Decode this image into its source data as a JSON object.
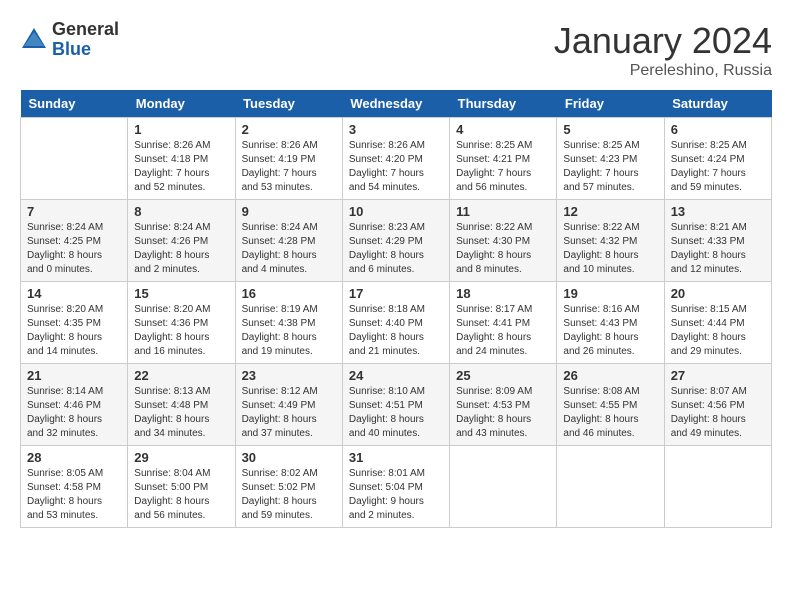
{
  "header": {
    "logo": {
      "general": "General",
      "blue": "Blue"
    },
    "month": "January 2024",
    "location": "Pereleshino, Russia"
  },
  "weekdays": [
    "Sunday",
    "Monday",
    "Tuesday",
    "Wednesday",
    "Thursday",
    "Friday",
    "Saturday"
  ],
  "weeks": [
    [
      {
        "day": "",
        "info": ""
      },
      {
        "day": "1",
        "info": "Sunrise: 8:26 AM\nSunset: 4:18 PM\nDaylight: 7 hours\nand 52 minutes."
      },
      {
        "day": "2",
        "info": "Sunrise: 8:26 AM\nSunset: 4:19 PM\nDaylight: 7 hours\nand 53 minutes."
      },
      {
        "day": "3",
        "info": "Sunrise: 8:26 AM\nSunset: 4:20 PM\nDaylight: 7 hours\nand 54 minutes."
      },
      {
        "day": "4",
        "info": "Sunrise: 8:25 AM\nSunset: 4:21 PM\nDaylight: 7 hours\nand 56 minutes."
      },
      {
        "day": "5",
        "info": "Sunrise: 8:25 AM\nSunset: 4:23 PM\nDaylight: 7 hours\nand 57 minutes."
      },
      {
        "day": "6",
        "info": "Sunrise: 8:25 AM\nSunset: 4:24 PM\nDaylight: 7 hours\nand 59 minutes."
      }
    ],
    [
      {
        "day": "7",
        "info": "Sunrise: 8:24 AM\nSunset: 4:25 PM\nDaylight: 8 hours\nand 0 minutes."
      },
      {
        "day": "8",
        "info": "Sunrise: 8:24 AM\nSunset: 4:26 PM\nDaylight: 8 hours\nand 2 minutes."
      },
      {
        "day": "9",
        "info": "Sunrise: 8:24 AM\nSunset: 4:28 PM\nDaylight: 8 hours\nand 4 minutes."
      },
      {
        "day": "10",
        "info": "Sunrise: 8:23 AM\nSunset: 4:29 PM\nDaylight: 8 hours\nand 6 minutes."
      },
      {
        "day": "11",
        "info": "Sunrise: 8:22 AM\nSunset: 4:30 PM\nDaylight: 8 hours\nand 8 minutes."
      },
      {
        "day": "12",
        "info": "Sunrise: 8:22 AM\nSunset: 4:32 PM\nDaylight: 8 hours\nand 10 minutes."
      },
      {
        "day": "13",
        "info": "Sunrise: 8:21 AM\nSunset: 4:33 PM\nDaylight: 8 hours\nand 12 minutes."
      }
    ],
    [
      {
        "day": "14",
        "info": "Sunrise: 8:20 AM\nSunset: 4:35 PM\nDaylight: 8 hours\nand 14 minutes."
      },
      {
        "day": "15",
        "info": "Sunrise: 8:20 AM\nSunset: 4:36 PM\nDaylight: 8 hours\nand 16 minutes."
      },
      {
        "day": "16",
        "info": "Sunrise: 8:19 AM\nSunset: 4:38 PM\nDaylight: 8 hours\nand 19 minutes."
      },
      {
        "day": "17",
        "info": "Sunrise: 8:18 AM\nSunset: 4:40 PM\nDaylight: 8 hours\nand 21 minutes."
      },
      {
        "day": "18",
        "info": "Sunrise: 8:17 AM\nSunset: 4:41 PM\nDaylight: 8 hours\nand 24 minutes."
      },
      {
        "day": "19",
        "info": "Sunrise: 8:16 AM\nSunset: 4:43 PM\nDaylight: 8 hours\nand 26 minutes."
      },
      {
        "day": "20",
        "info": "Sunrise: 8:15 AM\nSunset: 4:44 PM\nDaylight: 8 hours\nand 29 minutes."
      }
    ],
    [
      {
        "day": "21",
        "info": "Sunrise: 8:14 AM\nSunset: 4:46 PM\nDaylight: 8 hours\nand 32 minutes."
      },
      {
        "day": "22",
        "info": "Sunrise: 8:13 AM\nSunset: 4:48 PM\nDaylight: 8 hours\nand 34 minutes."
      },
      {
        "day": "23",
        "info": "Sunrise: 8:12 AM\nSunset: 4:49 PM\nDaylight: 8 hours\nand 37 minutes."
      },
      {
        "day": "24",
        "info": "Sunrise: 8:10 AM\nSunset: 4:51 PM\nDaylight: 8 hours\nand 40 minutes."
      },
      {
        "day": "25",
        "info": "Sunrise: 8:09 AM\nSunset: 4:53 PM\nDaylight: 8 hours\nand 43 minutes."
      },
      {
        "day": "26",
        "info": "Sunrise: 8:08 AM\nSunset: 4:55 PM\nDaylight: 8 hours\nand 46 minutes."
      },
      {
        "day": "27",
        "info": "Sunrise: 8:07 AM\nSunset: 4:56 PM\nDaylight: 8 hours\nand 49 minutes."
      }
    ],
    [
      {
        "day": "28",
        "info": "Sunrise: 8:05 AM\nSunset: 4:58 PM\nDaylight: 8 hours\nand 53 minutes."
      },
      {
        "day": "29",
        "info": "Sunrise: 8:04 AM\nSunset: 5:00 PM\nDaylight: 8 hours\nand 56 minutes."
      },
      {
        "day": "30",
        "info": "Sunrise: 8:02 AM\nSunset: 5:02 PM\nDaylight: 8 hours\nand 59 minutes."
      },
      {
        "day": "31",
        "info": "Sunrise: 8:01 AM\nSunset: 5:04 PM\nDaylight: 9 hours\nand 2 minutes."
      },
      {
        "day": "",
        "info": ""
      },
      {
        "day": "",
        "info": ""
      },
      {
        "day": "",
        "info": ""
      }
    ]
  ]
}
